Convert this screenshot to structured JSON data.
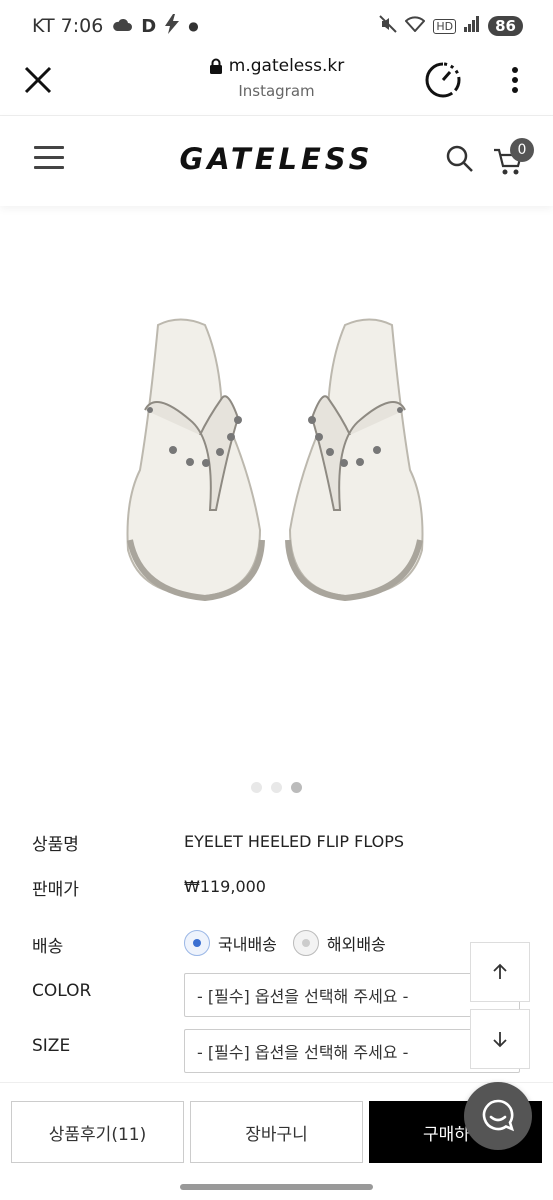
{
  "status_bar": {
    "carrier_time": "KT 7:06",
    "icons_left": [
      "cloud-icon",
      "d-app-icon",
      "bolt-icon",
      "dot-icon"
    ],
    "hd_label": "HD",
    "battery": "86"
  },
  "browser": {
    "url": "m.gateless.kr",
    "source": "Instagram"
  },
  "site": {
    "logo": "GATELESS",
    "cart_count": "0"
  },
  "gallery": {
    "slide_count": 3,
    "active_slide": 3
  },
  "product": {
    "name_label": "상품명",
    "name": "EYELET HEELED FLIP FLOPS",
    "price_label": "판매가",
    "price": "₩119,000",
    "shipping_label": "배송",
    "shipping_options": [
      "국내배송",
      "해외배송"
    ],
    "shipping_selected": "국내배송",
    "color_label": "COLOR",
    "color_select": "- [필수] 옵션을 선택해 주세요 -",
    "size_label": "SIZE",
    "size_select": "- [필수] 옵션을 선택해 주세요 -"
  },
  "bottom_bar": {
    "review": "상품후기(11)",
    "cart": "장바구니",
    "buy": "구매하"
  },
  "colors": {
    "buy_button": "#000000",
    "radio_selected": "#3b6fd1",
    "chat_button": "#555555"
  }
}
